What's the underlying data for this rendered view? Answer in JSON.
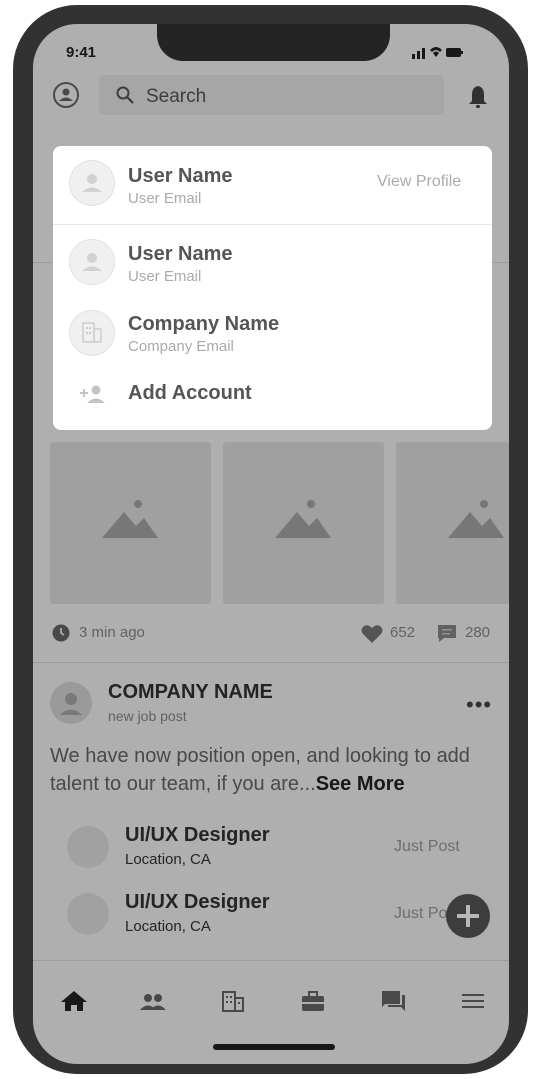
{
  "status_bar": {
    "time": "9:41"
  },
  "search": {
    "placeholder": "Search"
  },
  "feed": {
    "timestamp": "3 min ago",
    "likes": "652",
    "comments": "280",
    "company_post": {
      "company_name": "COMPANY NAME",
      "subtitle": "new job post",
      "body": "We have now position open, and looking to add talent to our team, if you are...",
      "see_more": "See More",
      "jobs": [
        {
          "title": "UI/UX Designer",
          "location": "Location, CA",
          "time": "Just Post"
        },
        {
          "title": "UI/UX Designer",
          "location": "Location, CA",
          "time": "Just Post"
        }
      ]
    }
  },
  "account_menu": {
    "current": {
      "name": "User Name",
      "email": "User Email",
      "action": "View Profile"
    },
    "accounts": [
      {
        "name": "User Name",
        "email": "User Email"
      },
      {
        "name": "Company Name",
        "email": "Company Email"
      }
    ],
    "add_account": "Add Account"
  },
  "bottom_nav": {
    "items": [
      "home-icon",
      "people-icon",
      "company-icon",
      "jobs-icon",
      "messages-icon",
      "menu-icon"
    ]
  },
  "colors": {
    "overlay": "#00000047",
    "frame": "#323232",
    "panel": "#ffffff"
  }
}
